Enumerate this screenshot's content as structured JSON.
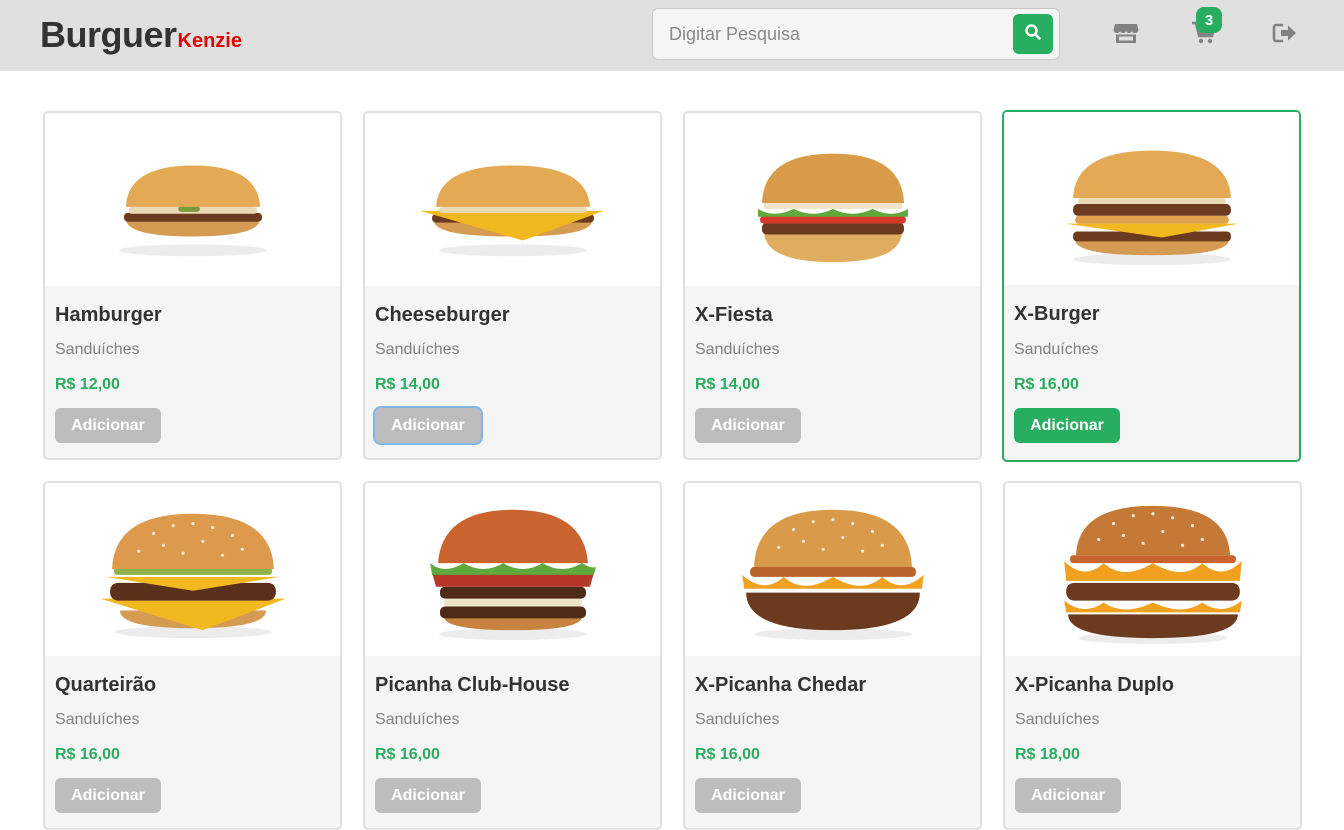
{
  "header": {
    "logo_main": "Burguer",
    "logo_sub": "Kenzie",
    "search_placeholder": "Digitar Pesquisa",
    "cart_count": "3",
    "icons": {
      "search": "search-icon",
      "store": "store-icon",
      "cart": "cart-icon",
      "logout": "logout-icon"
    }
  },
  "colors": {
    "accent": "#27ae60",
    "brand_red": "#e60000",
    "button_disabled": "#bdbdbd",
    "header_bg": "#e0e0e0"
  },
  "products": [
    {
      "name": "Hamburger",
      "category": "Sanduíches",
      "price": "R$ 12,00",
      "button": "Adicionar"
    },
    {
      "name": "Cheeseburger",
      "category": "Sanduíches",
      "price": "R$ 14,00",
      "button": "Adicionar"
    },
    {
      "name": "X-Fiesta",
      "category": "Sanduíches",
      "price": "R$ 14,00",
      "button": "Adicionar"
    },
    {
      "name": "X-Burger",
      "category": "Sanduíches",
      "price": "R$ 16,00",
      "button": "Adicionar"
    },
    {
      "name": "Quarteirão",
      "category": "Sanduíches",
      "price": "R$ 16,00",
      "button": "Adicionar"
    },
    {
      "name": "Picanha Club-House",
      "category": "Sanduíches",
      "price": "R$ 16,00",
      "button": "Adicionar"
    },
    {
      "name": "X-Picanha Chedar",
      "category": "Sanduíches",
      "price": "R$ 16,00",
      "button": "Adicionar"
    },
    {
      "name": "X-Picanha Duplo",
      "category": "Sanduíches",
      "price": "R$ 18,00",
      "button": "Adicionar"
    }
  ]
}
